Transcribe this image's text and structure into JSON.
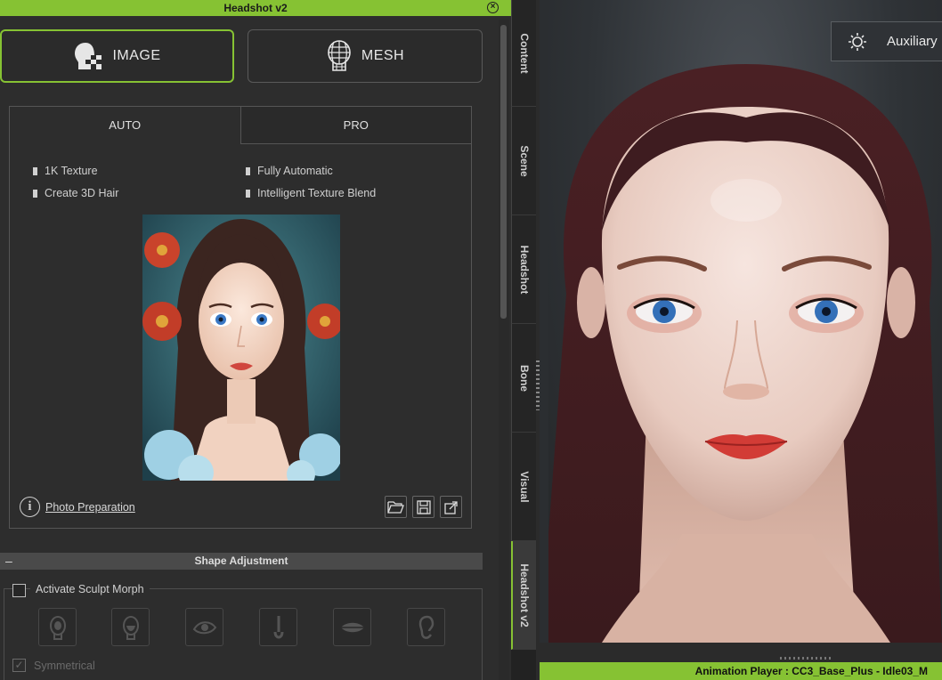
{
  "window": {
    "title": "Headshot v2"
  },
  "mode_buttons": {
    "image": "IMAGE",
    "mesh": "MESH"
  },
  "tabs": {
    "auto": "AUTO",
    "pro": "PRO"
  },
  "features": [
    "1K Texture",
    "Fully Automatic",
    "Create 3D Hair",
    "Intelligent Texture Blend"
  ],
  "photo_preparation": "Photo Preparation",
  "shape_adjustment": {
    "header": "Shape Adjustment",
    "collapse_symbol": "–"
  },
  "sculpt": {
    "activate_label": "Activate Sculpt Morph",
    "symmetrical_label": "Symmetrical",
    "symmetrical_check": "✓"
  },
  "side_tabs": [
    "Content",
    "Scene",
    "Headshot",
    "Bone",
    "Visual",
    "Headshot v2"
  ],
  "viewport": {
    "auxiliary_label": "Auxiliary"
  },
  "status_bar": {
    "text": "Animation Player : CC3_Base_Plus - Idle03_M"
  },
  "icons": {
    "close": "close-icon",
    "image_mode": "head-checker-icon",
    "mesh_mode": "head-mesh-icon",
    "info": "info-icon",
    "open": "folder-open-icon",
    "save": "save-icon",
    "export": "export-icon",
    "light": "sun-icon"
  },
  "colors": {
    "accent": "#86c233",
    "panel": "#2d2d2d",
    "viewport": "#2b2e31"
  }
}
